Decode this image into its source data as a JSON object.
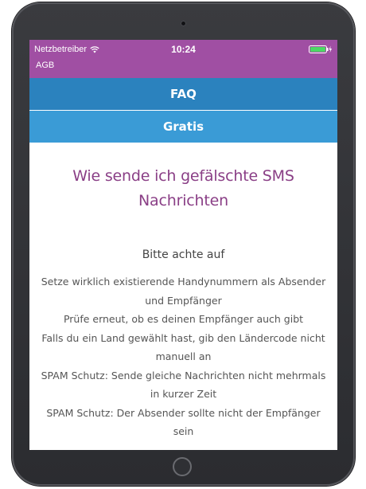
{
  "status_bar": {
    "carrier": "Netzbetreiber",
    "time": "10:24",
    "wifi_icon": "wifi-icon",
    "battery_icon": "battery-charging-icon"
  },
  "header": {
    "agb_label": "AGB",
    "color": "#a04fa3"
  },
  "nav": {
    "faq_label": "FAQ",
    "gratis_label": "Gratis",
    "faq_color": "#2b82be",
    "gratis_color": "#3a9bd6"
  },
  "main": {
    "title": "Wie sende ich gefälschte SMS Nachrichten",
    "subtitle": "Bitte achte auf",
    "tips": [
      "Setze wirklich existierende Handynummern als Absender und Empfänger",
      "Prüfe erneut, ob es deinen Empfänger auch gibt",
      "Falls du ein Land gewählt hast, gib den Ländercode nicht manuell an",
      "SPAM Schutz: Sende gleiche Nachrichten nicht mehrmals in kurzer Zeit",
      "SPAM Schutz: Der Absender sollte nicht der Empfänger sein"
    ]
  }
}
